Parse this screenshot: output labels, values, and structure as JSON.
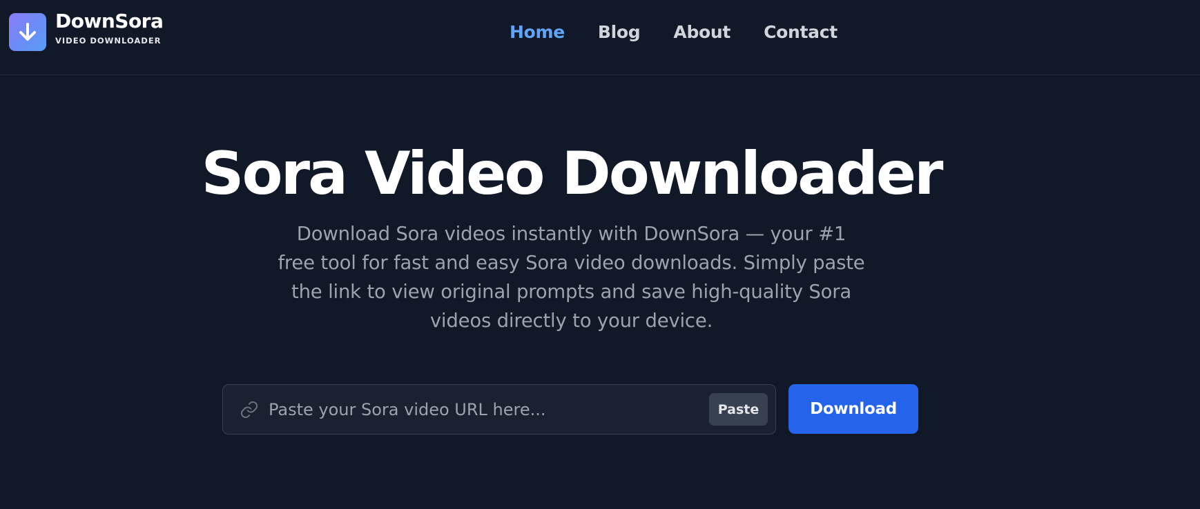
{
  "brand": {
    "name": "DownSora",
    "tagline": "VIDEO DOWNLOADER",
    "icon": "download-arrow-icon",
    "gradient_colors": [
      "#8b7cf6",
      "#5a9cf7"
    ]
  },
  "nav": {
    "items": [
      {
        "label": "Home",
        "active": true
      },
      {
        "label": "Blog",
        "active": false
      },
      {
        "label": "About",
        "active": false
      },
      {
        "label": "Contact",
        "active": false
      }
    ],
    "active_color": "#60a5fa"
  },
  "hero": {
    "title": "Sora Video Downloader",
    "description": "Download Sora videos instantly with DownSora — your #1 free tool for fast and easy Sora video downloads. Simply paste the link to view original prompts and save high-quality Sora videos directly to your device."
  },
  "search": {
    "icon": "link-icon",
    "placeholder": "Paste your Sora video URL here...",
    "value": "",
    "paste_label": "Paste",
    "download_label": "Download"
  },
  "colors": {
    "background": "#111827",
    "accent": "#2563eb"
  }
}
